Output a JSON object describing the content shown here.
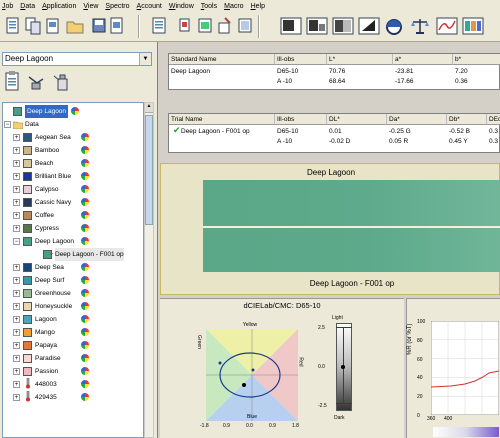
{
  "menu": [
    "Job",
    "Data",
    "Application",
    "View",
    "Spectro",
    "Account",
    "Window",
    "Tools",
    "Macro",
    "Help"
  ],
  "combo": {
    "value": "Deep Lagoon"
  },
  "tree": {
    "root": {
      "label": "Deep Lagoon",
      "color": "#4a9e88"
    },
    "folder": {
      "label": "Data"
    },
    "items": [
      {
        "label": "Aegean Sea",
        "color": "#2c5a7a",
        "expander": "+"
      },
      {
        "label": "Bamboo",
        "color": "#c8b888",
        "expander": "+"
      },
      {
        "label": "Beach",
        "color": "#d8c8a0",
        "expander": "+"
      },
      {
        "label": "Brilliant Blue",
        "color": "#1838a0",
        "expander": "+"
      },
      {
        "label": "Calypso",
        "color": "#e8d0d8",
        "expander": "+"
      },
      {
        "label": "Cassic Navy",
        "color": "#283858",
        "expander": "+"
      },
      {
        "label": "Coffee",
        "color": "#b88858",
        "expander": "+"
      },
      {
        "label": "Cypress",
        "color": "#587848",
        "expander": "+"
      },
      {
        "label": "Deep Lagoon",
        "color": "#4a9e88",
        "expander": "−"
      },
      {
        "label": "Deep Lagoon - F001 op",
        "color": "#4a9e88",
        "child": true,
        "selected": true
      },
      {
        "label": "Deep Sea",
        "color": "#184878",
        "expander": "+"
      },
      {
        "label": "Deep Surf",
        "color": "#3898a8",
        "expander": "+"
      },
      {
        "label": "Greenhouse",
        "color": "#98b898",
        "expander": "+"
      },
      {
        "label": "Honeysuckle",
        "color": "#e8d8b0",
        "expander": "+"
      },
      {
        "label": "Lagoon",
        "color": "#48a8b8",
        "expander": "+"
      },
      {
        "label": "Mango",
        "color": "#f0a030",
        "expander": "+"
      },
      {
        "label": "Papaya",
        "color": "#e07838",
        "expander": "+"
      },
      {
        "label": "Paradise",
        "color": "#f8d8d0",
        "expander": "+"
      },
      {
        "label": "Passion",
        "color": "#f0b8c0",
        "expander": "+"
      },
      {
        "label": "448003",
        "color": "#808080",
        "expander": "+",
        "thermo": true
      },
      {
        "label": "429435",
        "color": "#808080",
        "expander": "+",
        "thermo": true
      }
    ]
  },
  "standard_table": {
    "headers": [
      "Standard Name",
      "Ill-obs",
      "L*",
      "a*",
      "b*"
    ],
    "rows": [
      [
        "Deep Lagoon",
        "D65-10",
        "70.76",
        "-23.81",
        "7.20"
      ],
      [
        "",
        "A   -10",
        "68.64",
        "-17.66",
        "0.36"
      ]
    ]
  },
  "trial_table": {
    "headers": [
      "Trial Name",
      "Ill-obs",
      "DL*",
      "Da*",
      "Db*",
      "DEcm"
    ],
    "rows": [
      [
        "Deep Lagoon - F001 op",
        "D65-10",
        "0.01",
        "-0.25 G",
        "-0.52 B",
        "0.3"
      ],
      [
        "",
        "A   -10",
        "-0.02 D",
        "0.05 R",
        "0.45 Y",
        "0.3"
      ]
    ]
  },
  "swatch": {
    "top_label": "Deep Lagoon",
    "bottom_label": "Deep Lagoon - F001 op",
    "color": "#5aa888"
  },
  "dcie": {
    "title": "dCIELab/CMC: D65-10",
    "yellow": "Yellow",
    "blue": "Blue",
    "green": "Green",
    "red": "Red",
    "light": "Light",
    "dark": "Dark",
    "x_ticks": [
      "-1.8",
      "0.9",
      "0.0",
      "0.9",
      "1.8"
    ],
    "l_ticks": [
      "2.5",
      "0.0",
      "-2.5"
    ]
  },
  "spectral": {
    "y_label": "%R (or %T)",
    "y_ticks": [
      "100",
      "80",
      "60",
      "40",
      "20",
      "0"
    ],
    "x_ticks": [
      "360",
      "400"
    ]
  }
}
